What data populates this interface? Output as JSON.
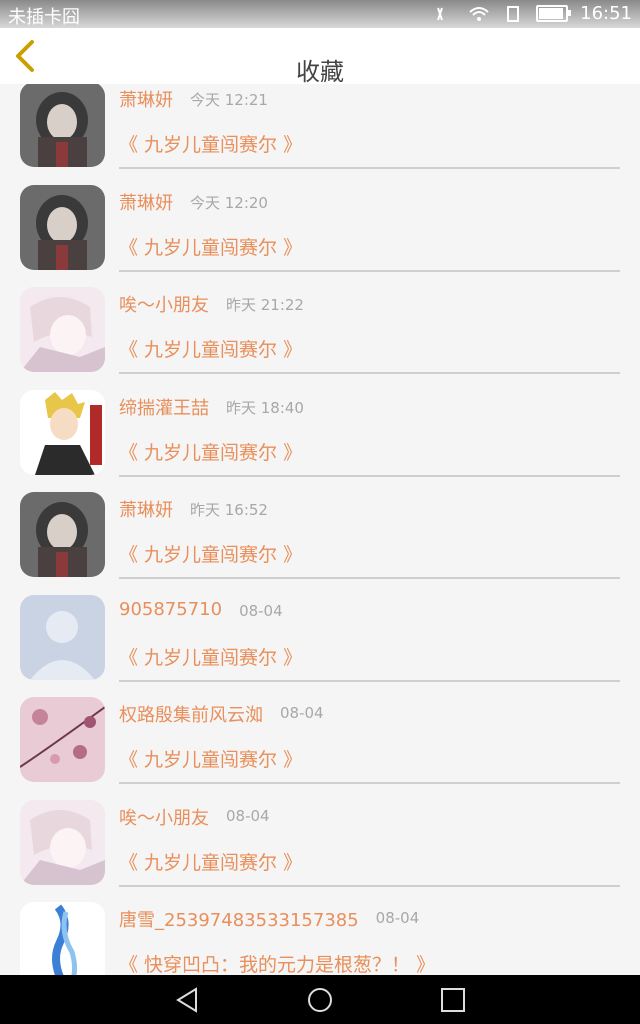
{
  "status_bar": {
    "carrier": "未插卡囧",
    "time": "16:51"
  },
  "header": {
    "title": "收藏",
    "back_icon": "chevron-left-icon",
    "accent": "#c8a000"
  },
  "items": [
    {
      "name": "萧琳妍",
      "time": "今天 12:21",
      "book": "《 九岁儿童闯赛尔 》",
      "avatar": "girl-dark"
    },
    {
      "name": "萧琳妍",
      "time": "今天 12:20",
      "book": "《 九岁儿童闯赛尔 》",
      "avatar": "girl-dark"
    },
    {
      "name": "唉～小朋友",
      "time": "昨天 21:22",
      "book": "《 九岁儿童闯赛尔 》",
      "avatar": "boy-pink"
    },
    {
      "name": "缔揣灌王喆",
      "time": "昨天 18:40",
      "book": "《 九岁儿童闯赛尔 》",
      "avatar": "anime-blond"
    },
    {
      "name": "萧琳妍",
      "time": "昨天 16:52",
      "book": "《 九岁儿童闯赛尔 》",
      "avatar": "girl-dark"
    },
    {
      "name": "905875710",
      "time": "08-04",
      "book": "《 九岁儿童闯赛尔 》",
      "avatar": "default-person"
    },
    {
      "name": "权路殷集前风云洳",
      "time": "08-04",
      "book": "《 九岁儿童闯赛尔 》",
      "avatar": "flower-branch"
    },
    {
      "name": "唉～小朋友",
      "time": "08-04",
      "book": "《 九岁儿童闯赛尔 》",
      "avatar": "boy-pink"
    },
    {
      "name": "唐雪_25397483533157385",
      "time": "08-04",
      "book": "《 快穿凹凸：我的元力是根葱？！ 》",
      "avatar": "blue-figure"
    }
  ],
  "colors": {
    "name": "#e98f5b",
    "time": "#a8a8a8",
    "divider": "#cfcfcf"
  }
}
